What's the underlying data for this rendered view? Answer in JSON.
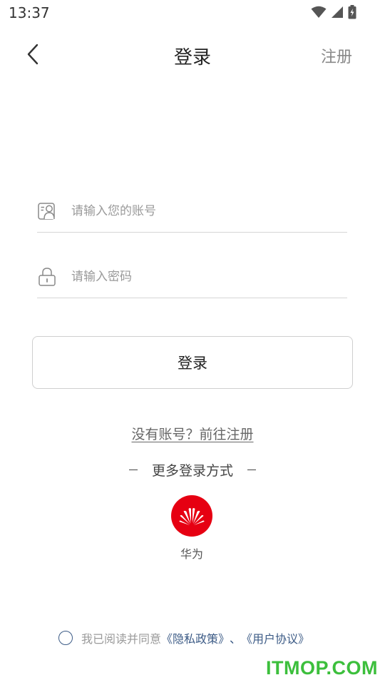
{
  "status_bar": {
    "time": "13:37"
  },
  "header": {
    "title": "登录",
    "register_label": "注册"
  },
  "form": {
    "account_placeholder": "请输入您的账号",
    "account_value": "",
    "password_placeholder": "请输入密码",
    "password_value": "",
    "login_label": "登录"
  },
  "signup_prompt": "没有账号？前往注册",
  "more_login": {
    "label": "更多登录方式",
    "providers": [
      {
        "name": "华为",
        "icon": "huawei-logo-icon",
        "color": "#e60012"
      }
    ]
  },
  "agreement": {
    "prefix": "我已阅读并同意",
    "privacy_link": "《隐私政策》",
    "separator": "、",
    "terms_link": "《用户协议》",
    "checked": false,
    "link_color": "#3c5b86"
  },
  "watermark": "ITMOP.COM"
}
